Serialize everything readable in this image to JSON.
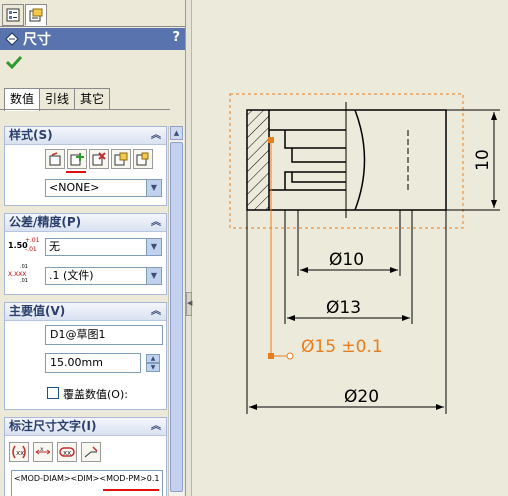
{
  "panel": {
    "title": "尺寸",
    "help": "?",
    "tabs": [
      "数值",
      "引线",
      "其它"
    ],
    "style_group": {
      "title": "样式(S)",
      "style_select": "<NONE>"
    },
    "tolerance_group": {
      "title": "公差/精度(P)",
      "tolerance_icon_top": "1.50",
      "tolerance_icon_sup": "+.01",
      "tolerance_icon_sub": "-.01",
      "precision_icon_top": ".01",
      "precision_icon_mid": "X.XXX",
      "precision_icon_bot": ".01",
      "tolerance_type": "无",
      "precision": ".1 (文件)"
    },
    "primary_group": {
      "title": "主要值(V)",
      "dimension_name": "D1@草图1",
      "value": "15.00mm",
      "override_label": "覆盖数值(O):"
    },
    "dimtext_group": {
      "title": "标注尺寸文字(I)",
      "text": "<MOD-DIAM><DIM><MOD-PM>0.1"
    }
  },
  "drawing": {
    "dim_10_vertical": "10",
    "dim_phi10": "Ø10",
    "dim_phi13": "Ø13",
    "dim_phi15": "Ø15 ±0.1",
    "dim_phi20": "Ø20",
    "colors": {
      "selected": "#e87d1e",
      "line": "#000000",
      "background": "#eceadb"
    }
  }
}
